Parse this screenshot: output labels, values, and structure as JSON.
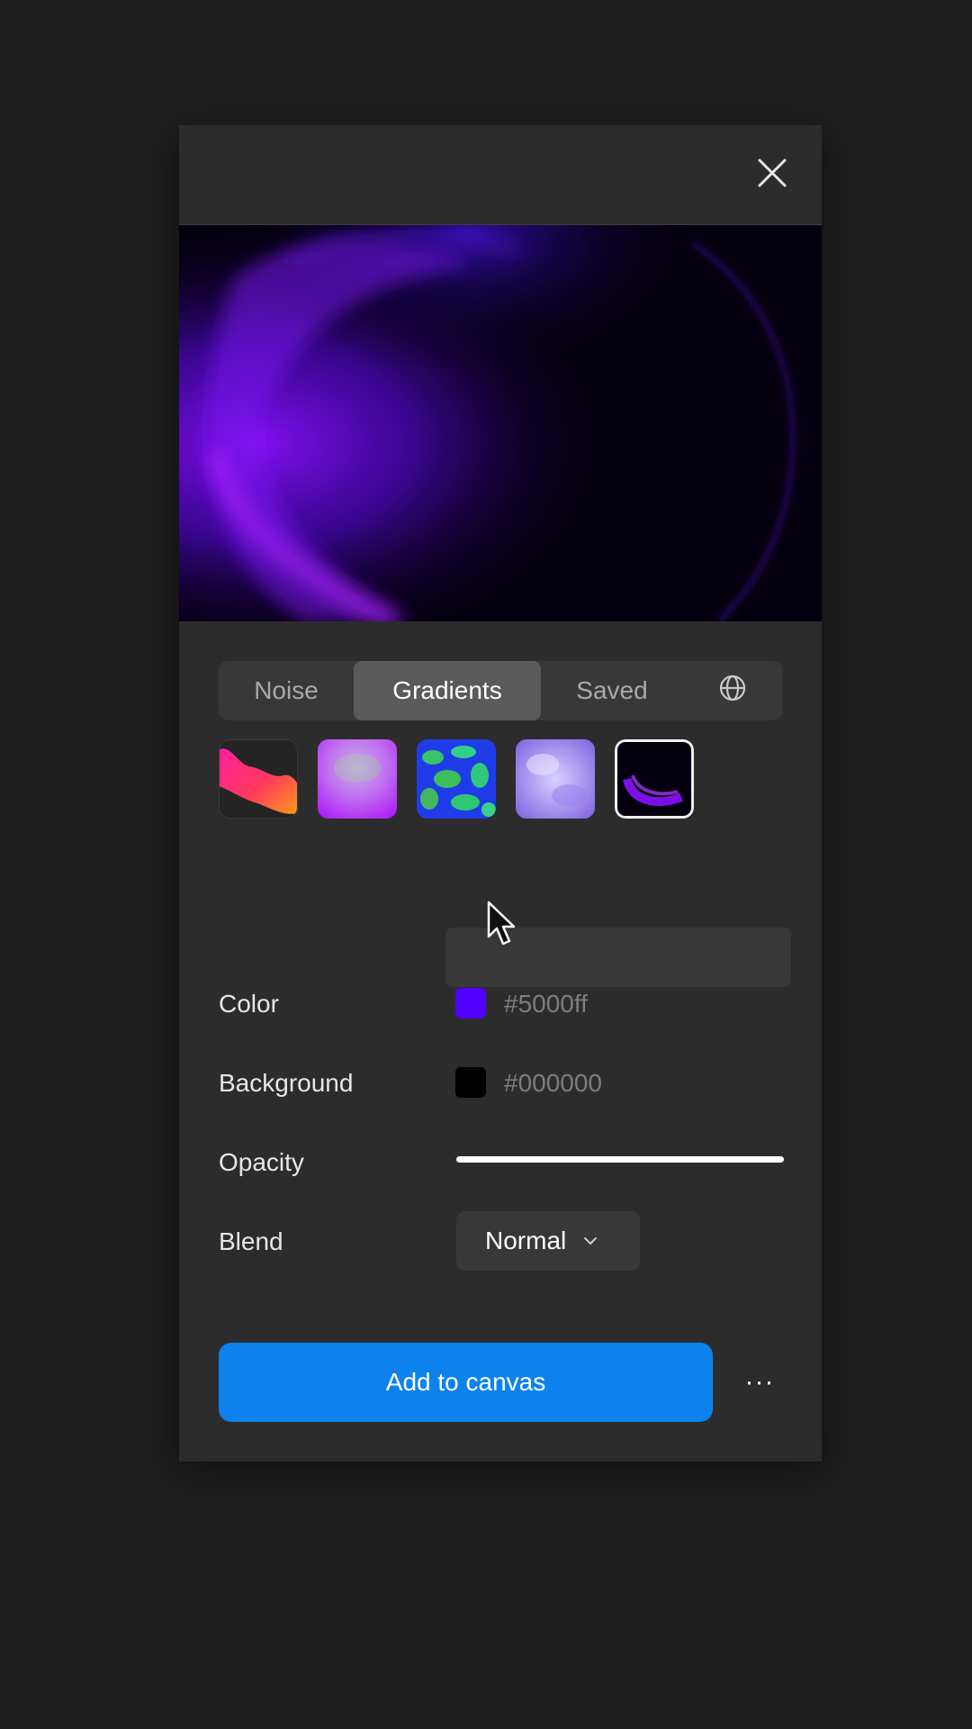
{
  "tabs": {
    "noise": "Noise",
    "gradients": "Gradients",
    "saved": "Saved",
    "globe_icon": "globe-icon",
    "active": "Gradients"
  },
  "presets": [
    {
      "name": "preset-wave-orange"
    },
    {
      "name": "preset-purple-cloud"
    },
    {
      "name": "preset-green-blue-camo"
    },
    {
      "name": "preset-lavender-cloud"
    },
    {
      "name": "preset-dark-purple-arc",
      "selected": true
    }
  ],
  "fields": {
    "color_label": "Color",
    "color_value": "#5000ff",
    "background_label": "Background",
    "background_value": "#000000",
    "opacity_label": "Opacity",
    "opacity_fraction": 1.0,
    "blend_label": "Blend",
    "blend_value": "Normal"
  },
  "actions": {
    "add_to_canvas": "Add to canvas",
    "more": "···"
  },
  "colors": {
    "accent": "#0d82ee",
    "swatch_color": "#5000ff",
    "swatch_background": "#000000",
    "panel": "#2c2c2c",
    "page": "#1f1f1f"
  }
}
